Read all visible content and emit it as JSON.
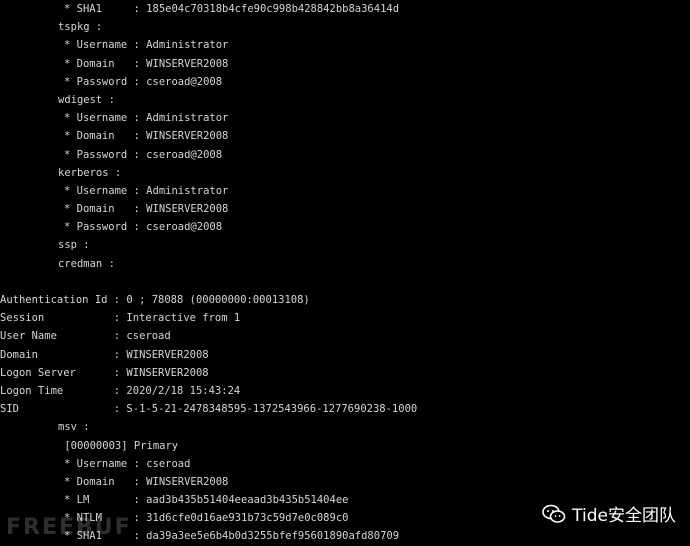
{
  "lines": [
    {
      "indent": 2,
      "text": "* SHA1     : 185e04c70318b4cfe90c998b428842bb8a36414d"
    },
    {
      "indent": 1,
      "text": "tspkg :"
    },
    {
      "indent": 2,
      "text": "* Username : Administrator"
    },
    {
      "indent": 2,
      "text": "* Domain   : WINSERVER2008"
    },
    {
      "indent": 2,
      "text": "* Password : cseroad@2008"
    },
    {
      "indent": 1,
      "text": "wdigest :"
    },
    {
      "indent": 2,
      "text": "* Username : Administrator"
    },
    {
      "indent": 2,
      "text": "* Domain   : WINSERVER2008"
    },
    {
      "indent": 2,
      "text": "* Password : cseroad@2008"
    },
    {
      "indent": 1,
      "text": "kerberos :"
    },
    {
      "indent": 2,
      "text": "* Username : Administrator"
    },
    {
      "indent": 2,
      "text": "* Domain   : WINSERVER2008"
    },
    {
      "indent": 2,
      "text": "* Password : cseroad@2008"
    },
    {
      "indent": 1,
      "text": "ssp :"
    },
    {
      "indent": 1,
      "text": "credman :"
    },
    {
      "indent": 0,
      "text": ""
    },
    {
      "indent": 0,
      "text": "Authentication Id : 0 ; 78088 (00000000:00013108)"
    },
    {
      "indent": 0,
      "text": "Session           : Interactive from 1"
    },
    {
      "indent": 0,
      "text": "User Name         : cseroad"
    },
    {
      "indent": 0,
      "text": "Domain            : WINSERVER2008"
    },
    {
      "indent": 0,
      "text": "Logon Server      : WINSERVER2008"
    },
    {
      "indent": 0,
      "text": "Logon Time        : 2020/2/18 15:43:24"
    },
    {
      "indent": 0,
      "text": "SID               : S-1-5-21-2478348595-1372543966-1277690238-1000"
    },
    {
      "indent": 1,
      "text": "msv :"
    },
    {
      "indent": 1,
      "text": " [00000003] Primary"
    },
    {
      "indent": 2,
      "text": "* Username : cseroad"
    },
    {
      "indent": 2,
      "text": "* Domain   : WINSERVER2008"
    },
    {
      "indent": 2,
      "text": "* LM       : aad3b435b51404eeaad3b435b51404ee"
    },
    {
      "indent": 2,
      "text": "* NTLM     : 31d6cfe0d16ae931b73c59d7e0c089c0"
    },
    {
      "indent": 2,
      "text": "* SHA1     : da39a3ee5e6b4b0d3255bfef95601890afd80709"
    }
  ],
  "watermark": {
    "left_text": "FREEBUF",
    "right_text": "Tide安全团队",
    "icon": "wechat-icon"
  },
  "colors": {
    "background": "#000000",
    "text": "#d6d6d6"
  }
}
